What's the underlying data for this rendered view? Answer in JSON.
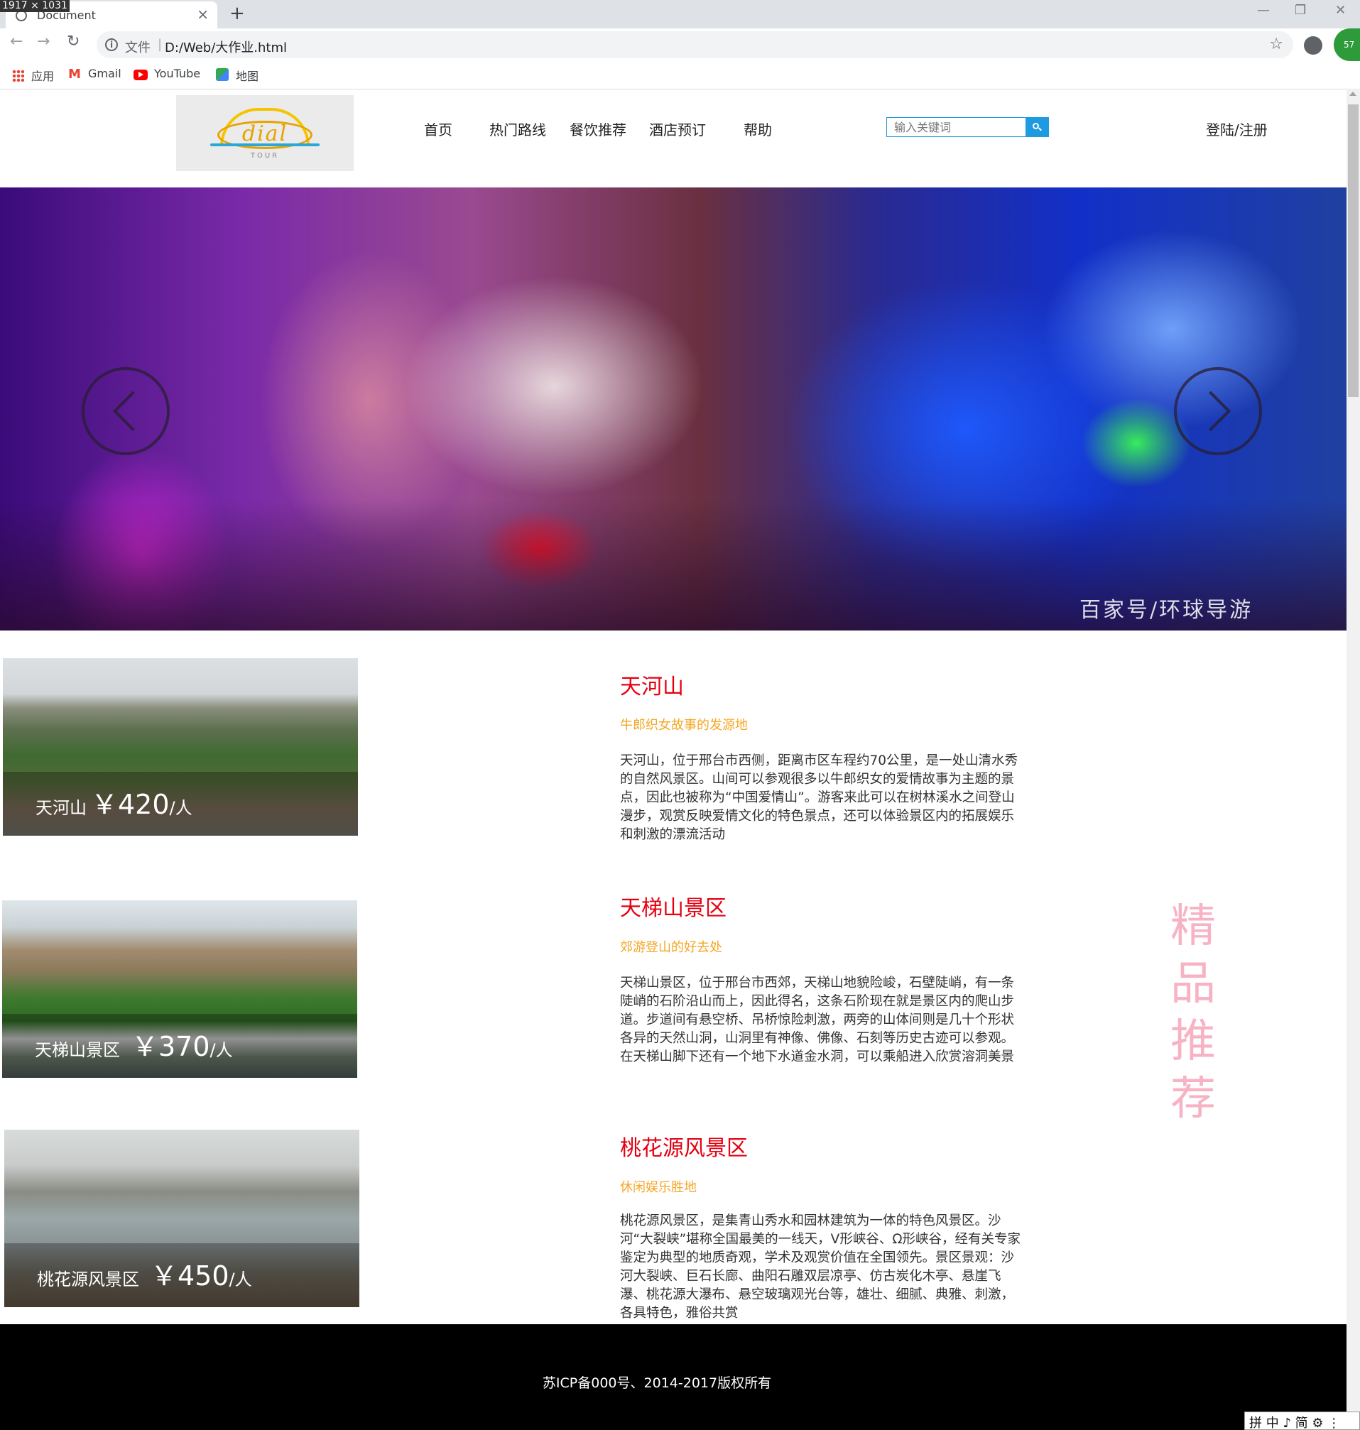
{
  "screen": {
    "dimensions_badge": "1917 × 1031"
  },
  "browser": {
    "tab_title": "Document",
    "tab_close": "×",
    "new_tab": "+",
    "minimize": "—",
    "restore": "❐",
    "close": "✕",
    "back": "←",
    "forward": "→",
    "reload": "↻",
    "url_prefix": "文件",
    "url_separator": "|",
    "url": "D:/Web/大作业.html",
    "star": "☆",
    "extension_badge": "57"
  },
  "bookmarks": [
    {
      "label": "应用",
      "icon": "apps-grid-icon"
    },
    {
      "label": "Gmail",
      "icon": "gmail-icon"
    },
    {
      "label": "YouTube",
      "icon": "youtube-icon"
    },
    {
      "label": "地图",
      "icon": "maps-icon"
    }
  ],
  "header": {
    "logo_text": "dial",
    "logo_sub": "TOUR",
    "nav": [
      "首页",
      "热门路线",
      "餐饮推荐",
      "酒店预订",
      "帮助"
    ],
    "search_placeholder": "输入关键词",
    "login": "登陆/注册"
  },
  "banner": {
    "watermark": "百家号/环球导游"
  },
  "items": [
    {
      "image_caption_name": "天河山",
      "price": "￥420",
      "unit": "/人",
      "title": "天河山",
      "subtitle": "牛郎织女故事的发源地",
      "description": "天河山，位于邢台市西侧，距离市区车程约70公里，是一处山清水秀的自然风景区。山间可以参观很多以牛郎织女的爱情故事为主题的景点，因此也被称为“中国爱情山”。游客来此可以在树林溪水之间登山漫步，观赏反映爱情文化的特色景点，还可以体验景区内的拓展娱乐和刺激的漂流活动"
    },
    {
      "image_caption_name": "天梯山景区",
      "price": "￥370",
      "unit": "/人",
      "title": "天梯山景区",
      "subtitle": "郊游登山的好去处",
      "description": "天梯山景区，位于邢台市西郊，天梯山地貌险峻，石壁陡峭，有一条陡峭的石阶沿山而上，因此得名，这条石阶现在就是景区内的爬山步道。步道间有悬空桥、吊桥惊险刺激，两旁的山体间则是几十个形状各异的天然山洞，山洞里有神像、佛像、石刻等历史古迹可以参观。在天梯山脚下还有一个地下水道金水洞，可以乘船进入欣赏溶洞美景"
    },
    {
      "image_caption_name": "桃花源风景区",
      "price": "￥450",
      "unit": "/人",
      "title": "桃花源风景区",
      "subtitle": "休闲娱乐胜地",
      "description": "桃花源风景区，是集青山秀水和园林建筑为一体的特色风景区。沙河“大裂峡”堪称全国最美的一线天，V形峡谷、Ω形峡谷，经有关专家鉴定为典型的地质奇观，学术及观赏价值在全国领先。景区景观：沙河大裂峡、巨石长廊、曲阳石雕双层凉亭、仿古炭化木亭、悬崖飞瀑、桃花源大瀑布、悬空玻璃观光台等，雄壮、细腻、典雅、刺激，各具特色，雅俗共赏"
    }
  ],
  "side_title": "精品推荐",
  "footer": {
    "text": "苏ICP备000号、2014-2017版权所有"
  },
  "ime": "拼 中 ♪ 简 ⚙ ⋮"
}
